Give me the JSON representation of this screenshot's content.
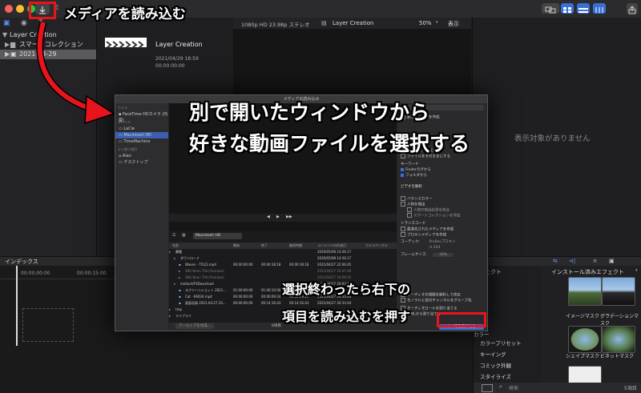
{
  "toolbar": {
    "import_icon": "download-arrow",
    "keys_icon": "key"
  },
  "sidebar": {
    "items": [
      {
        "label": "Layer Creation"
      },
      {
        "label": "スマートコレクション"
      },
      {
        "label": "2021-04-29"
      }
    ]
  },
  "browser": {
    "clip_title": "Layer Creation",
    "clip_date": "2021/04/29 18:59",
    "clip_tc": "00:00:00:00"
  },
  "viewer": {
    "format": "1080p HD 23.98p ステレオ",
    "project": "Layer Creation",
    "zoom": "50%",
    "view_menu": "表示"
  },
  "inspector": {
    "empty_text": "表示対象がありません"
  },
  "timeline": {
    "index_label": "インデックス",
    "tc_start": "00:00:00:00",
    "tc_mark": "00:00:15:00"
  },
  "effects": {
    "left_header": "エフェクト",
    "right_header": "インストール済みエフェクト",
    "categories": [
      "カラー",
      "カラープリセット",
      "キーイング",
      "コミック外観",
      "スタイライズ"
    ],
    "thumbs": [
      "イメージマスク",
      "グラデーションマスク",
      "シェイプマスク",
      "ビネットマスク"
    ],
    "count": "5項目",
    "search_placeholder": "検索"
  },
  "dialog": {
    "title": "メディアの読み込み",
    "sidebar_cameras_hdr": "カメラ",
    "camera": "FaceTime HDカメラ (内蔵)",
    "devices_hdr": "デバイス",
    "devices": [
      "LaCie",
      "Macintosh HD",
      "TimeMachine"
    ],
    "favorites_hdr": "よく使う項目",
    "favorites": [
      "Alan",
      "デスクトップ"
    ],
    "location": "Macintosh HD",
    "columns": [
      "名前",
      "開始",
      "終了",
      "継続時間",
      "コンテンツの作成日",
      "カメラアングル"
    ],
    "files": [
      {
        "name": "書籍",
        "start": "",
        "end": "",
        "dur": "",
        "date": "2020/05/08 14:26:17"
      },
      {
        "name": "ダウンロード",
        "start": "",
        "end": "",
        "dur": "",
        "date": "2020/05/08 14:26:17"
      },
      {
        "name": "Waves - 7f122.mp4",
        "start": "00:00:00:00",
        "end": "00:00:18:18",
        "dur": "00:00:18:18",
        "date": "2021/04/27 22:06:45"
      },
      {
        "name": "SNS Neon Title(Youtube)",
        "start": "",
        "end": "",
        "dur": "",
        "date": "2021/04/27 16:47:46"
      },
      {
        "name": "SNS Neon Title(Youtube)",
        "start": "",
        "end": "",
        "dur": "",
        "date": "2021/04/27 18:08:45"
      },
      {
        "name": "motionVFXDownload",
        "start": "",
        "end": "",
        "dur": "",
        "date": "2021/04/27 20:03:38"
      },
      {
        "name": "スクリーンショット 2021...",
        "start": "01:00:00:00",
        "end": "01:00:10:00",
        "dur": "00:00:10:00",
        "date": "2021/04/28 19:43:38"
      },
      {
        "name": "Cat - 66034.mp4",
        "start": "00:00:00:00",
        "end": "00:00:09:24",
        "dur": "00:00:09:24",
        "date": "2021/04/27 20:33:44"
      },
      {
        "name": "画面収録 2021-04-27 20...",
        "start": "00:00:00:00",
        "end": "00:14:16:43",
        "dur": "00:14:16:43",
        "date": "2021/04/27 20:33:44"
      },
      {
        "name": "tmp",
        "start": "",
        "end": "",
        "dur": "",
        "date": ""
      },
      {
        "name": "ライブラリ",
        "start": "",
        "end": "",
        "dur": "",
        "date": ""
      }
    ],
    "archive_button": "アーカイブを作成...",
    "selected_count": "8項目",
    "import_button": "すべてを読み込む",
    "options": {
      "new_event": "新規イベントを作成",
      "copy_library": "ライブラリにコピー",
      "leave_files": "ファイルをそのままにする",
      "keywords_hdr": "キーワード",
      "finder_tags": "Finderタグから",
      "folders": "フォルダから",
      "video_hdr": "ビデオを解析",
      "balance_color": "バランスカラー",
      "find_people": "人物を検出",
      "people_a": "人物の検出結果を統合",
      "people_b": "スマートコレクションを作成",
      "transcode_hdr": "トランスコード",
      "optimized": "最適化されたメディアを作成",
      "proxy": "プロキシメディアを作成",
      "codec_label": "コーデック:",
      "codec_value": "ProResプロキシ",
      "h264": "H.264",
      "frame_size_label": "フレームサイズ:",
      "frame_size_value": "50%",
      "audio_a": "オーディオの問題を解析して修正",
      "audio_b": "モノラルと空のチャンネルをグループ化",
      "audio_c": "オーディオロールを割り当てる",
      "audio_d": "iXMLから割り当てる"
    }
  },
  "annotations": {
    "top": "メディアを読み込む",
    "middle_1": "別で開いたウィンドウから",
    "middle_2": "好きな動画ファイルを選択する",
    "bottom_1": "選択終わったら右下の",
    "bottom_2": "項目を読み込むを押す"
  },
  "colors": {
    "accent": "#3a6fd8",
    "highlight": "#e8141c"
  }
}
